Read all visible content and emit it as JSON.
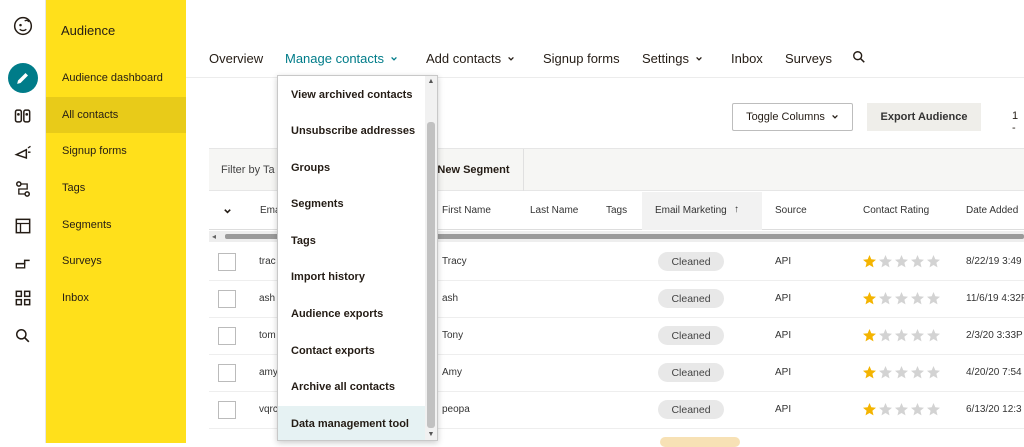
{
  "sidebar": {
    "title": "Audience",
    "items": [
      {
        "label": "Audience dashboard"
      },
      {
        "label": "All contacts"
      },
      {
        "label": "Signup forms"
      },
      {
        "label": "Tags"
      },
      {
        "label": "Segments"
      },
      {
        "label": "Surveys"
      },
      {
        "label": "Inbox"
      }
    ]
  },
  "nav": {
    "items": [
      {
        "label": "Overview"
      },
      {
        "label": "Manage contacts"
      },
      {
        "label": "Add contacts"
      },
      {
        "label": "Signup forms"
      },
      {
        "label": "Settings"
      },
      {
        "label": "Inbox"
      },
      {
        "label": "Surveys"
      }
    ]
  },
  "toolbar": {
    "toggle_columns": "Toggle Columns",
    "export": "Export Audience",
    "pager": "1 -"
  },
  "filter": {
    "label": "Filter by Ta",
    "new_segment": "New Segment"
  },
  "table": {
    "headers": {
      "email": "Ema",
      "first_name": "First Name",
      "last_name": "Last Name",
      "tags": "Tags",
      "email_marketing": "Email Marketing",
      "sort_arrow": "↑",
      "source": "Source",
      "rating": "Contact Rating",
      "date_added": "Date Added"
    },
    "rows": [
      {
        "email": "trac",
        "first": "Tracy",
        "status": "Cleaned",
        "source": "API",
        "rating": 1,
        "date": "8/22/19 3:49"
      },
      {
        "email": "ash",
        "first": "ash",
        "status": "Cleaned",
        "source": "API",
        "rating": 1,
        "date": "11/6/19 4:32P"
      },
      {
        "email": "tom",
        "first": "Tony",
        "status": "Cleaned",
        "source": "API",
        "rating": 1,
        "date": "2/3/20 3:33P"
      },
      {
        "email": "amy",
        "first": "Amy",
        "status": "Cleaned",
        "source": "API",
        "rating": 1,
        "date": "4/20/20 7:54"
      },
      {
        "email": "vqrc",
        "first": "peopa",
        "status": "Cleaned",
        "source": "API",
        "rating": 1,
        "date": "6/13/20 12:3"
      }
    ]
  },
  "dropdown": {
    "items": [
      {
        "label": "View archived contacts"
      },
      {
        "label": "Unsubscribe addresses"
      },
      {
        "label": "Groups"
      },
      {
        "label": "Segments"
      },
      {
        "label": "Tags"
      },
      {
        "label": "Import history"
      },
      {
        "label": "Audience exports"
      },
      {
        "label": "Contact exports"
      },
      {
        "label": "Archive all contacts"
      },
      {
        "label": "Data management tool"
      }
    ],
    "scroll_up": "▲",
    "scroll_down": "▼"
  },
  "colors": {
    "sidebar_bg": "#ffe01b",
    "accent": "#007c89",
    "star_filled": "#f4b400",
    "star_empty": "#d3d3d3"
  },
  "icons": {
    "logo": "freddie-logo-icon",
    "create": "pencil-icon",
    "audience": "audience-icon",
    "campaigns": "megaphone-icon",
    "automations": "automation-icon",
    "website": "website-icon",
    "integrations": "integrations-icon",
    "dashboard": "grid-icon",
    "search": "search-icon"
  }
}
